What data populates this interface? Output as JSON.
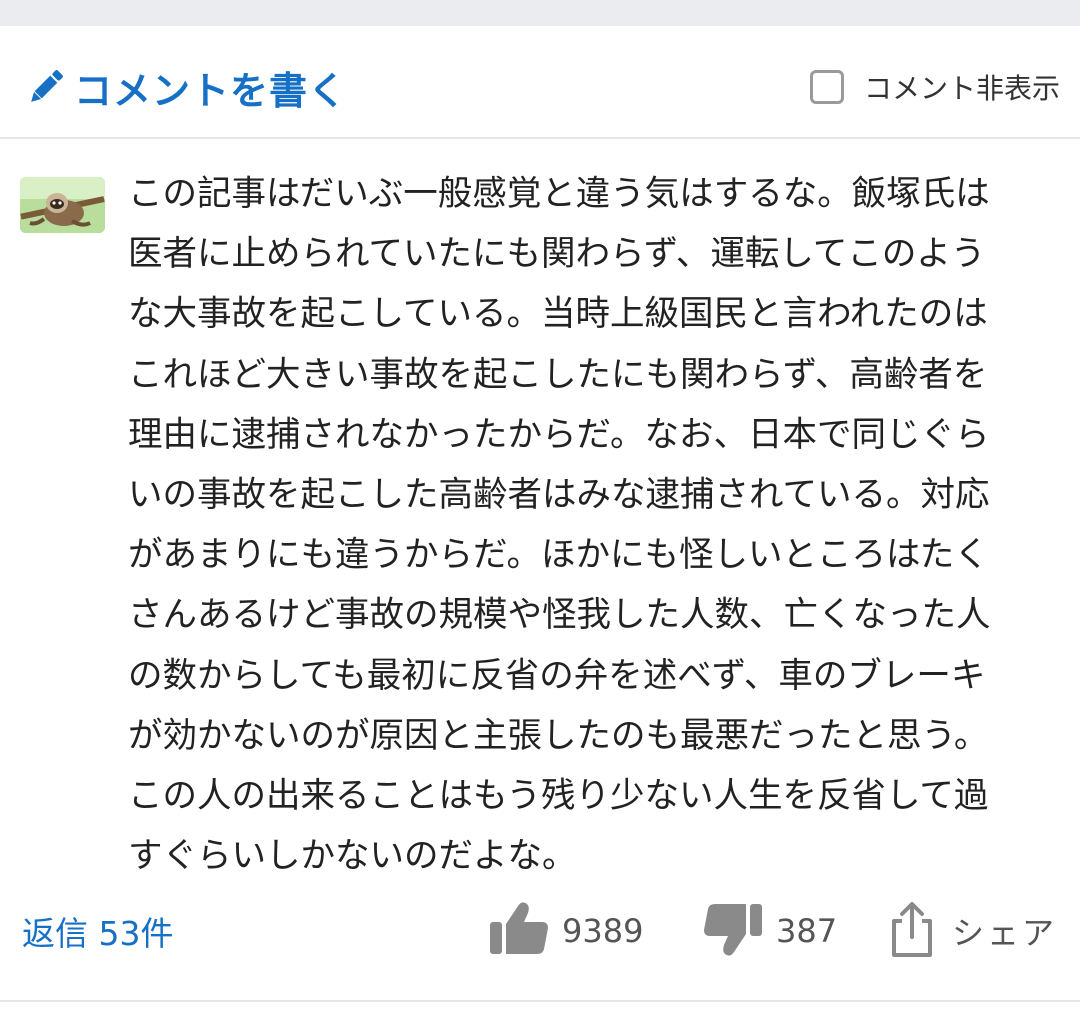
{
  "header": {
    "write_comment_label": "コメントを書く",
    "hide_comments_label": "コメント非表示",
    "hide_comments_checked": false
  },
  "comment": {
    "avatar_icon": "sloth-avatar-photo",
    "lines": [
      "この記事はだいぶ一般感覚と違う気はするな。飯塚氏は",
      "医者に止められていたにも関わらず、運転してこのよう",
      "な大事故を起こしている。当時上級国民と言われたのは",
      "これほど大きい事故を起こしたにも関わらず、高齢者を",
      "理由に逮捕されなかったからだ。なお、日本で同じぐら",
      "いの事故を起こした高齢者はみな逮捕されている。対応",
      "があまりにも違うからだ。ほかにも怪しいところはたく",
      "さんあるけど事故の規模や怪我した人数、亡くなった人",
      "の数からしても最初に反省の弁を述べず、車のブレーキ",
      "が効かないのが原因と主張したのも最悪だったと思う。",
      "この人の出来ることはもう残り少ない人生を反省して過",
      "すぐらいしかないのだよな。"
    ]
  },
  "footer": {
    "reply_label": "返信 53件",
    "like_count": "9389",
    "dislike_count": "387",
    "share_label": "シェア"
  },
  "colors": {
    "accent": "#1670c6",
    "text": "#222222",
    "muted": "#555555",
    "icon_gray": "#8a8a8a",
    "divider": "#e6e6e6",
    "top_strip": "#eaecef"
  }
}
